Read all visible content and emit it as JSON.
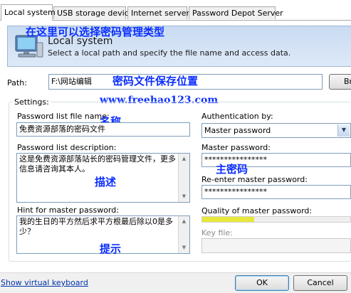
{
  "tabs": [
    {
      "label": "Local system",
      "active": true
    },
    {
      "label": "USB storage device",
      "active": false
    },
    {
      "label": "Internet server",
      "active": false
    },
    {
      "label": "Password Depot Server",
      "active": false
    }
  ],
  "header": {
    "title": "Local system",
    "subtitle": "Select a local path and specify the file name and access data.",
    "annotation": "在这里可以选择密码管理类型"
  },
  "path": {
    "label": "Path:",
    "value": "F:\\网站编辑",
    "annotation": "密码文件保存位置",
    "browse_label": "Br"
  },
  "watermark": "www.freehao123.com",
  "settings": {
    "legend": "Settings:",
    "file_name_label": "Password list file name:",
    "file_name_value": "免费资源部落的密码文件",
    "file_name_annotation": "名称",
    "description_label": "Password list description:",
    "description_value": "这是免费资源部落站长的密码管理文件，更多信息请咨询其本人。",
    "description_annotation": "描述",
    "hint_label": "Hint for master password:",
    "hint_value": "我的生日的平方然后求平方根最后除以0是多少？",
    "hint_annotation": "提示",
    "auth_label": "Authentication by:",
    "auth_value": "Master password",
    "master_label": "Master password:",
    "master_value": "****************",
    "master_annotation": "主密码",
    "reenter_label": "Re-enter master password:",
    "reenter_value": "****************",
    "quality_label": "Quality of master password:",
    "quality_level": 0.35,
    "quality_color": "#e8e83a",
    "keyfile_label": "Key file:",
    "keyfile_value": ""
  },
  "footer": {
    "keyboard_link": "Show virtual keyboard",
    "ok_label": "OK",
    "cancel_label": "Cancel"
  },
  "colors": {
    "annotation": "#0b2fff",
    "banner": "#d3e3f5",
    "link": "#0033aa"
  }
}
